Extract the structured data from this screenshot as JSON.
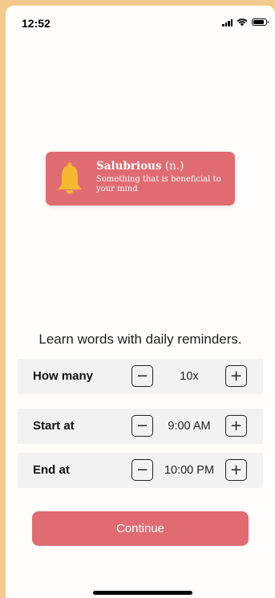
{
  "status_bar": {
    "time": "12:52"
  },
  "notification": {
    "word": "Salubrious",
    "part_of_speech": "(n.)",
    "definition": "Something that is beneficial to your mind"
  },
  "tagline": "Learn words with daily reminders.",
  "settings": [
    {
      "label": "How many",
      "value": "10x"
    },
    {
      "label": "Start at",
      "value": "9:00 AM"
    },
    {
      "label": "End at",
      "value": "10:00 PM"
    }
  ],
  "stepper": {
    "minus": "−",
    "plus": "+"
  },
  "continue_label": "Continue",
  "colors": {
    "accent": "#e06c72",
    "bell": "#f5b82e",
    "background": "#f3c98d",
    "row_bg": "#f2f2f3"
  },
  "icons": {
    "notification": "bell-icon",
    "signal": "signal-icon",
    "wifi": "wifi-icon",
    "battery": "battery-icon"
  }
}
